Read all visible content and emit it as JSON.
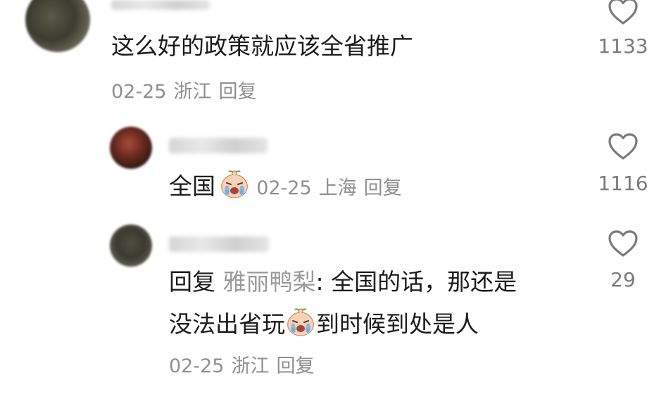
{
  "comments": [
    {
      "text": "这么好的政策就应该全省推广",
      "date": "02-25",
      "location": "浙江",
      "reply_label": "回复",
      "likes": "1133"
    },
    {
      "text": "全国",
      "emoji": "crying-emoji",
      "date": "02-25",
      "location": "上海",
      "reply_label": "回复",
      "likes": "1116"
    },
    {
      "reply_prefix": "回复",
      "mention": "雅丽鸭梨",
      "line1_rest": ": 全国的话，那还是",
      "line2_a": "没法出省玩",
      "emoji": "crying-emoji",
      "line2_b": "到时候到处是人",
      "date": "02-25",
      "location": "浙江",
      "reply_label": "回复",
      "likes": "29"
    }
  ],
  "icons": {
    "like": "heart-outline-icon"
  },
  "colors": {
    "text": "#1b1b1b",
    "meta": "#8f8f8f",
    "icon": "#7a7a7a"
  }
}
